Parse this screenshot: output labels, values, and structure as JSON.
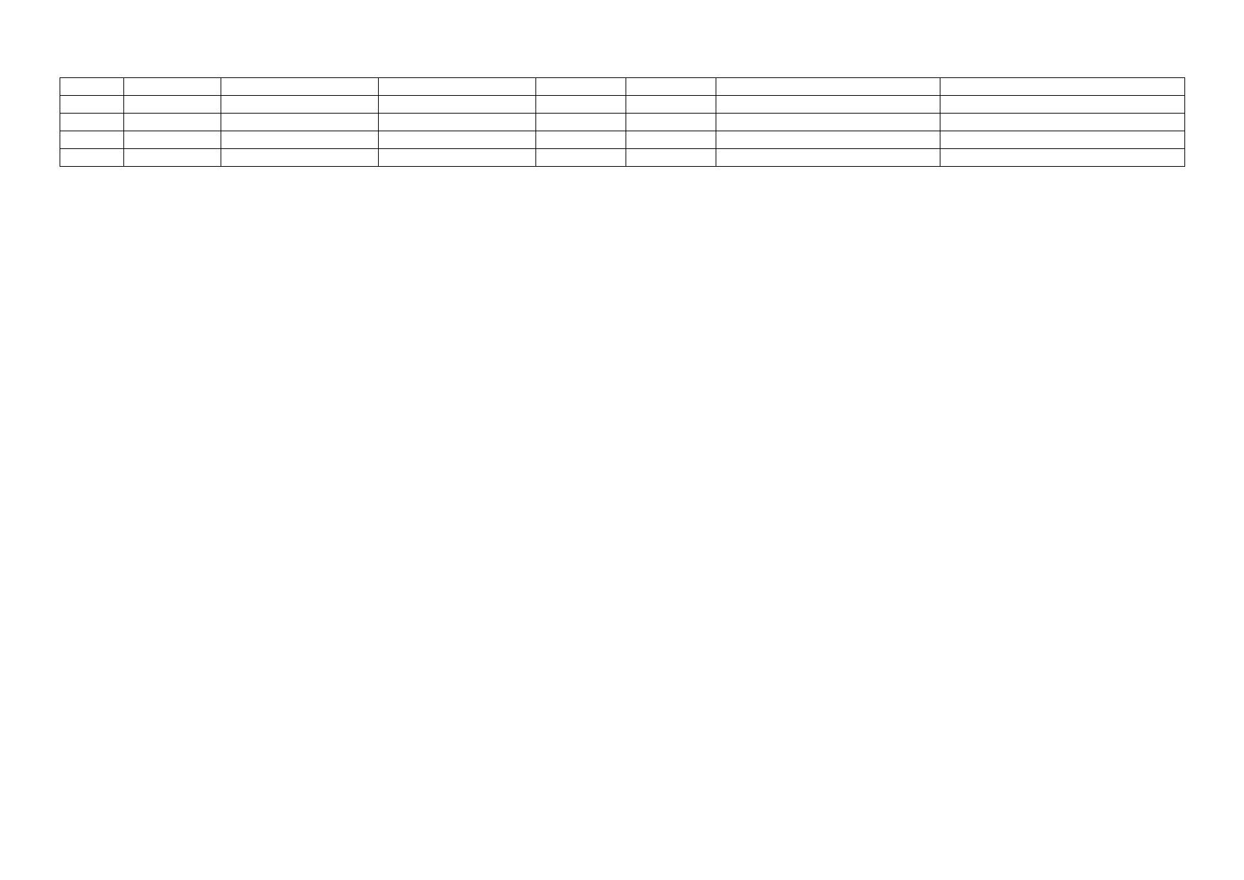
{
  "table": {
    "rows": [
      [
        "",
        "",
        "",
        "",
        "",
        "",
        "",
        ""
      ],
      [
        "",
        "",
        "",
        "",
        "",
        "",
        "",
        ""
      ],
      [
        "",
        "",
        "",
        "",
        "",
        "",
        "",
        ""
      ],
      [
        "",
        "",
        "",
        "",
        "",
        "",
        "",
        ""
      ],
      [
        "",
        "",
        "",
        "",
        "",
        "",
        "",
        ""
      ]
    ]
  }
}
